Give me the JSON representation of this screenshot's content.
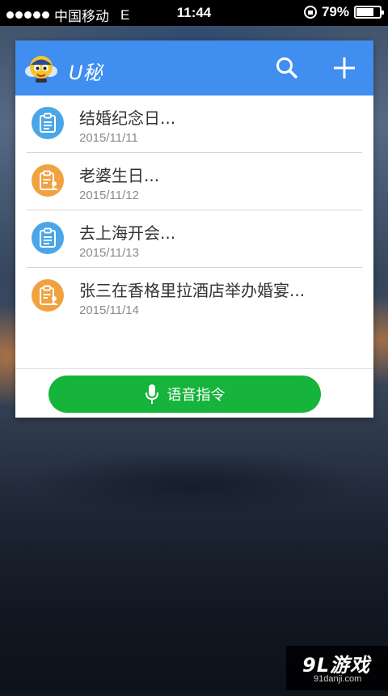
{
  "status_bar": {
    "carrier": "中国移动",
    "network": "E",
    "time": "11:44",
    "battery": "79%",
    "battery_level": 0.79
  },
  "widget": {
    "app_title": "U秘",
    "header_color": "#3f8ef0",
    "icons": {
      "logo": "bee-mascot-logo",
      "search": "search-icon",
      "add": "plus-icon"
    }
  },
  "notes": [
    {
      "title": "结婚纪念日...",
      "date": "2015/11/11",
      "icon": "clipboard-icon",
      "color": "#4aa6e8"
    },
    {
      "title": "老婆生日...",
      "date": "2015/11/12",
      "icon": "clipboard-person-icon",
      "color": "#f0a240"
    },
    {
      "title": "去上海开会...",
      "date": "2015/11/13",
      "icon": "clipboard-icon",
      "color": "#4aa6e8"
    },
    {
      "title": "张三在香格里拉酒店举办婚宴...",
      "date": "2015/11/14",
      "icon": "clipboard-person-icon",
      "color": "#f0a240"
    }
  ],
  "voice_button": {
    "label": "语音指令",
    "color": "#16b43a",
    "icon": "microphone-icon"
  },
  "watermark": {
    "main": "9L游戏",
    "sub": "91danji.com"
  }
}
